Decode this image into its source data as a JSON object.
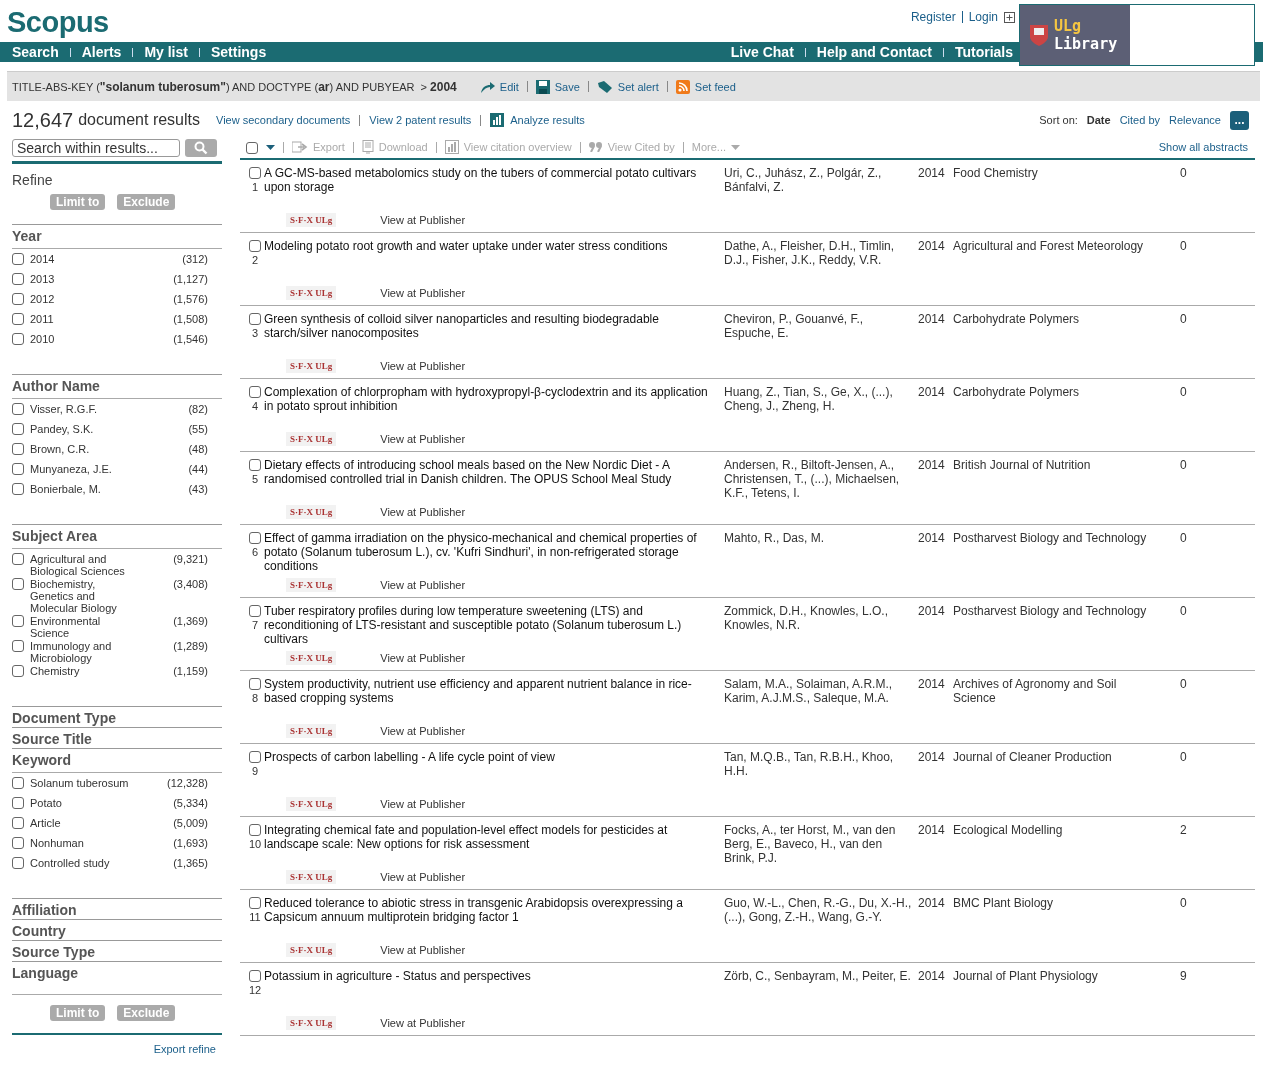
{
  "header": {
    "logo": "Scopus",
    "user_links": [
      "Register",
      "Login"
    ],
    "library_logo": [
      "ULg",
      "Library"
    ],
    "nav_left": [
      "Search",
      "Alerts",
      "My list",
      "Settings"
    ],
    "nav_right": [
      "Live Chat",
      "Help and Contact",
      "Tutorials"
    ]
  },
  "query": {
    "prefix": "TITLE-ABS-KEY (",
    "term": "\"solanum tuberosum\"",
    "middle": ") AND DOCTYPE (",
    "doctype": "ar",
    "suffix": ") AND PUBYEAR",
    "op": ">",
    "year": "2004",
    "actions": [
      {
        "kind": "edit",
        "label": "Edit"
      },
      {
        "kind": "save",
        "label": "Save"
      },
      {
        "kind": "alert",
        "label": "Set alert"
      },
      {
        "kind": "feed",
        "label": "Set feed"
      }
    ]
  },
  "results_bar": {
    "count": "12,647",
    "count_label": "document results",
    "links": [
      "View secondary documents",
      "View 2 patent results"
    ],
    "analyze": "Analyze results",
    "sort_label": "Sort on:",
    "sort_options": [
      {
        "label": "Date",
        "selected": true
      },
      {
        "label": "Cited by",
        "selected": false
      },
      {
        "label": "Relevance",
        "selected": false
      }
    ],
    "more_button": "..."
  },
  "search_within": {
    "placeholder": "Search within results..."
  },
  "refine": {
    "title": "Refine",
    "buttons": [
      "Limit to",
      "Exclude"
    ],
    "bottom_buttons": [
      "Limit to",
      "Exclude"
    ],
    "facets": [
      {
        "title": "Year",
        "items": [
          {
            "label": "2014",
            "count": "(312)",
            "checked": false
          },
          {
            "label": "2013",
            "count": "(1,127)",
            "checked": false
          },
          {
            "label": "2012",
            "count": "(1,576)",
            "checked": false
          },
          {
            "label": "2011",
            "count": "(1,508)",
            "checked": false
          },
          {
            "label": "2010",
            "count": "(1,546)",
            "checked": false
          }
        ]
      },
      {
        "title": "Author Name",
        "items": [
          {
            "label": "Visser, R.G.F.",
            "count": "(82)",
            "checked": false
          },
          {
            "label": "Pandey, S.K.",
            "count": "(55)",
            "checked": false
          },
          {
            "label": "Brown, C.R.",
            "count": "(48)",
            "checked": false
          },
          {
            "label": "Munyaneza, J.E.",
            "count": "(44)",
            "checked": false
          },
          {
            "label": "Bonierbale, M.",
            "count": "(43)",
            "checked": false
          }
        ]
      },
      {
        "title": "Subject Area",
        "items": [
          {
            "label": "Agricultural and Biological Sciences",
            "count": "(9,321)",
            "checked": false
          },
          {
            "label": "Biochemistry, Genetics and Molecular Biology",
            "count": "(3,408)",
            "checked": false
          },
          {
            "label": "Environmental Science",
            "count": "(1,369)",
            "checked": false
          },
          {
            "label": "Immunology and Microbiology",
            "count": "(1,289)",
            "checked": false
          },
          {
            "label": "Chemistry",
            "count": "(1,159)",
            "checked": false
          }
        ]
      },
      {
        "title": "Document Type"
      },
      {
        "title": "Source Title"
      },
      {
        "title": "Keyword",
        "items": [
          {
            "label": "Solanum tuberosum",
            "count": "(12,328)",
            "checked": false
          },
          {
            "label": "Potato",
            "count": "(5,334)",
            "checked": false
          },
          {
            "label": "Article",
            "count": "(5,009)",
            "checked": false
          },
          {
            "label": "Nonhuman",
            "count": "(1,693)",
            "checked": false
          },
          {
            "label": "Controlled study",
            "count": "(1,365)",
            "checked": false
          }
        ]
      },
      {
        "title": "Affiliation"
      },
      {
        "title": "Country"
      },
      {
        "title": "Source Type"
      },
      {
        "title": "Language"
      }
    ],
    "export": "Export refine"
  },
  "toolbar": {
    "select_all_checked": false,
    "items": [
      {
        "kind": "export",
        "label": "Export",
        "disabled": true
      },
      {
        "kind": "download",
        "label": "Download",
        "disabled": true
      },
      {
        "kind": "citation",
        "label": "View citation overview",
        "disabled": true
      },
      {
        "kind": "cited",
        "label": "View Cited by",
        "disabled": true
      },
      {
        "kind": "more",
        "label": "More...",
        "disabled": true
      }
    ],
    "show_abstracts": "Show all abstracts"
  },
  "results": [
    {
      "number": "1",
      "title": "A GC-MS-based metabolomics study on the tubers of commercial potato cultivars upon storage",
      "authors": "Uri, C., Juhász, Z., Polgár, Z., Bánfalvi, Z.",
      "year": "2014",
      "source": "Food Chemistry",
      "cited": "0",
      "resolver": "S·F·X ULg",
      "publisher": "View at Publisher",
      "checked": false
    },
    {
      "number": "2",
      "title": "Modeling potato root growth and water uptake under water stress conditions",
      "authors": "Dathe, A., Fleisher, D.H., Timlin, D.J., Fisher, J.K., Reddy, V.R.",
      "year": "2014",
      "source": "Agricultural and Forest Meteorology",
      "cited": "0",
      "resolver": "S·F·X ULg",
      "publisher": "View at Publisher",
      "checked": false
    },
    {
      "number": "3",
      "title": "Green synthesis of colloid silver nanoparticles and resulting biodegradable starch/silver nanocomposites",
      "authors": "Cheviron, P., Gouanvé, F., Espuche, E.",
      "year": "2014",
      "source": "Carbohydrate Polymers",
      "cited": "0",
      "resolver": "S·F·X ULg",
      "publisher": "View at Publisher",
      "checked": false
    },
    {
      "number": "4",
      "title": "Complexation of chlorpropham with hydroxypropyl-β-cyclodextrin and its application in potato sprout inhibition",
      "authors": "Huang, Z., Tian, S., Ge, X., (...), Cheng, J., Zheng, H.",
      "year": "2014",
      "source": "Carbohydrate Polymers",
      "cited": "0",
      "resolver": "S·F·X ULg",
      "publisher": "View at Publisher",
      "checked": false
    },
    {
      "number": "5",
      "title": "Dietary effects of introducing school meals based on the New Nordic Diet - A randomised controlled trial in Danish children. The OPUS School Meal Study",
      "authors": "Andersen, R., Biltoft-Jensen, A., Christensen, T., (...), Michaelsen, K.F., Tetens, I.",
      "year": "2014",
      "source": "British Journal of Nutrition",
      "cited": "0",
      "resolver": "S·F·X ULg",
      "publisher": "View at Publisher",
      "checked": false
    },
    {
      "number": "6",
      "title": "Effect of gamma irradiation on the physico-mechanical and chemical properties of potato (Solanum tuberosum L.), cv. 'Kufri Sindhuri', in non-refrigerated storage conditions",
      "authors": "Mahto, R., Das, M.",
      "year": "2014",
      "source": "Postharvest Biology and Technology",
      "cited": "0",
      "resolver": "S·F·X ULg",
      "publisher": "View at Publisher",
      "checked": false
    },
    {
      "number": "7",
      "title": "Tuber respiratory profiles during low temperature sweetening (LTS) and reconditioning of LTS-resistant and susceptible potato (Solanum tuberosum L.) cultivars",
      "authors": "Zommick, D.H., Knowles, L.O., Knowles, N.R.",
      "year": "2014",
      "source": "Postharvest Biology and Technology",
      "cited": "0",
      "resolver": "S·F·X ULg",
      "publisher": "View at Publisher",
      "checked": false
    },
    {
      "number": "8",
      "title": "System productivity, nutrient use efficiency and apparent nutrient balance in rice-based cropping systems",
      "authors": "Salam, M.A., Solaiman, A.R.M., Karim, A.J.M.S., Saleque, M.A.",
      "year": "2014",
      "source": "Archives of Agronomy and Soil Science",
      "cited": "0",
      "resolver": "S·F·X ULg",
      "publisher": "View at Publisher",
      "checked": false
    },
    {
      "number": "9",
      "title": "Prospects of carbon labelling - A life cycle point of view",
      "authors": "Tan, M.Q.B., Tan, R.B.H., Khoo, H.H.",
      "year": "2014",
      "source": "Journal of Cleaner Production",
      "cited": "0",
      "resolver": "S·F·X ULg",
      "publisher": "View at Publisher",
      "checked": false
    },
    {
      "number": "10",
      "title": "Integrating chemical fate and population-level effect models for pesticides at landscape scale: New options for risk assessment",
      "authors": "Focks, A., ter Horst, M., van den Berg, E., Baveco, H., van den Brink, P.J.",
      "year": "2014",
      "source": "Ecological Modelling",
      "cited": "2",
      "resolver": "S·F·X ULg",
      "publisher": "View at Publisher",
      "checked": false
    },
    {
      "number": "11",
      "title": "Reduced tolerance to abiotic stress in transgenic Arabidopsis overexpressing a Capsicum annuum multiprotein bridging factor 1",
      "authors": "Guo, W.-L., Chen, R.-G., Du, X.-H., (...), Gong, Z.-H., Wang, G.-Y.",
      "year": "2014",
      "source": "BMC Plant Biology",
      "cited": "0",
      "resolver": "S·F·X ULg",
      "publisher": "View at Publisher",
      "checked": false
    },
    {
      "number": "12",
      "title": "Potassium in agriculture - Status and perspectives",
      "authors": "Zörb, C., Senbayram, M., Peiter, E.",
      "year": "2014",
      "source": "Journal of Plant Physiology",
      "cited": "9",
      "resolver": "S·F·X ULg",
      "publisher": "View at Publisher",
      "checked": false
    }
  ]
}
